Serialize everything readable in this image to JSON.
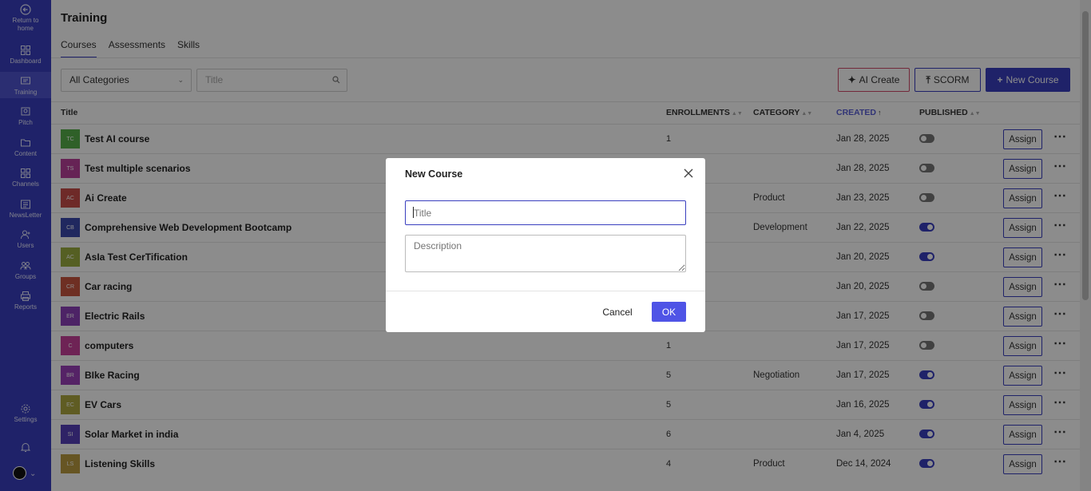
{
  "sidebar": {
    "items": [
      {
        "label1": "Return to",
        "label2": "home",
        "icon": "return-icon"
      },
      {
        "label1": "Dashboard",
        "icon": "dashboard-icon"
      },
      {
        "label1": "Training",
        "icon": "training-icon"
      },
      {
        "label1": "Pitch",
        "icon": "pitch-icon"
      },
      {
        "label1": "Content",
        "icon": "content-icon"
      },
      {
        "label1": "Channels",
        "icon": "channels-icon"
      },
      {
        "label1": "NewsLetter",
        "icon": "newsletter-icon"
      },
      {
        "label1": "Users",
        "icon": "users-icon"
      },
      {
        "label1": "Groups",
        "icon": "groups-icon"
      },
      {
        "label1": "Reports",
        "icon": "reports-icon"
      },
      {
        "label1": "Settings",
        "icon": "gear-icon"
      }
    ],
    "active": "Training"
  },
  "header": {
    "title": "Training",
    "tabs": [
      {
        "label": "Courses"
      },
      {
        "label": "Assessments"
      },
      {
        "label": "Skills"
      }
    ]
  },
  "filters": {
    "category_value": "All Categories",
    "title_placeholder": "Title"
  },
  "toolbar": {
    "ai_create_label": "AI Create",
    "scorm_label": "SCORM",
    "new_course_label": "New Course"
  },
  "table": {
    "columns": {
      "title": "Title",
      "enrollments": "ENROLLMENTS",
      "category": "CATEGORY",
      "created": "CREATED",
      "published": "PUBLISHED"
    },
    "assign_label": "Assign",
    "rows": [
      {
        "initials": "TC",
        "color": "#3aa32a",
        "title": "Test AI course",
        "enrollments": "1",
        "category": "",
        "created": "Jan 28, 2025",
        "published": false
      },
      {
        "initials": "TS",
        "color": "#b0208a",
        "title": "Test multiple scenarios",
        "enrollments": "",
        "category": "",
        "created": "Jan 28, 2025",
        "published": false
      },
      {
        "initials": "AC",
        "color": "#c0302a",
        "title": "Ai Create",
        "enrollments": "",
        "category": "Product",
        "created": "Jan 23, 2025",
        "published": false
      },
      {
        "initials": "CB",
        "color": "#1a2aa0",
        "title": "Comprehensive Web Development Bootcamp",
        "enrollments": "",
        "category": "Development",
        "created": "Jan 22, 2025",
        "published": true
      },
      {
        "initials": "AC",
        "color": "#8aa020",
        "title": "AsIa Test CerTification",
        "enrollments": "",
        "category": "",
        "created": "Jan 20, 2025",
        "published": true
      },
      {
        "initials": "CR",
        "color": "#c03a20",
        "title": "Car racing",
        "enrollments": "",
        "category": "",
        "created": "Jan 20, 2025",
        "published": false
      },
      {
        "initials": "ER",
        "color": "#7a20b0",
        "title": "Electric Rails",
        "enrollments": "",
        "category": "",
        "created": "Jan 17, 2025",
        "published": false
      },
      {
        "initials": "C",
        "color": "#c0208a",
        "title": "computers",
        "enrollments": "1",
        "category": "",
        "created": "Jan 17, 2025",
        "published": false
      },
      {
        "initials": "BR",
        "color": "#8a20b0",
        "title": "BIke Racing",
        "enrollments": "5",
        "category": "Negotiation",
        "created": "Jan 17, 2025",
        "published": true
      },
      {
        "initials": "EC",
        "color": "#a09a20",
        "title": "EV Cars",
        "enrollments": "5",
        "category": "",
        "created": "Jan 16, 2025",
        "published": true
      },
      {
        "initials": "SI",
        "color": "#3a20b0",
        "title": "Solar Market in india",
        "enrollments": "6",
        "category": "",
        "created": "Jan 4, 2025",
        "published": true
      },
      {
        "initials": "LS",
        "color": "#b08a20",
        "title": "Listening Skills",
        "enrollments": "4",
        "category": "Product",
        "created": "Dec 14, 2024",
        "published": true
      }
    ]
  },
  "modal": {
    "title": "New Course",
    "title_placeholder": "Title",
    "description_placeholder": "Description",
    "cancel_label": "Cancel",
    "ok_label": "OK"
  }
}
